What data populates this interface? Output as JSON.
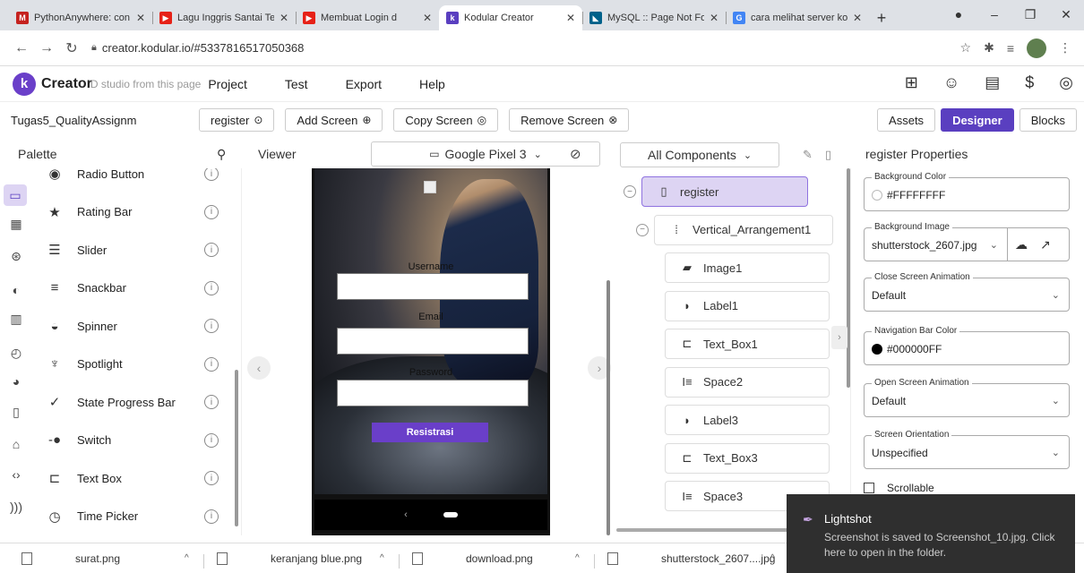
{
  "browser": {
    "tabs": [
      {
        "label": "PythonAnywhere: con",
        "favicon": "M",
        "color": "#c5221f",
        "active": false
      },
      {
        "label": "Lagu Inggris Santai Te",
        "favicon": "▶",
        "color": "#e62117",
        "active": false
      },
      {
        "label": "Membuat Login d",
        "favicon": "▶",
        "color": "#e62117",
        "active": false
      },
      {
        "label": "Kodular Creator",
        "favicon": "k",
        "color": "#5a3fc0",
        "active": true
      },
      {
        "label": "MySQL :: Page Not Fo",
        "favicon": "◣",
        "color": "#00618a",
        "active": false
      },
      {
        "label": "cara melihat server ko",
        "favicon": "G",
        "color": "#4285f4",
        "active": false
      }
    ],
    "new_tab": "+",
    "window_controls": {
      "record": "●",
      "minimize": "–",
      "maximize": "❐",
      "close": "✕"
    },
    "url": "creator.kodular.io/#5337816517050368"
  },
  "app": {
    "brand": "Creator",
    "ghost_text": "D    studio from this page",
    "menu": [
      "Project",
      "Test",
      "Export",
      "Help"
    ],
    "project_name": "Tugas5_QualityAssignm",
    "screen_select": "register",
    "buttons": {
      "add_screen": "Add Screen",
      "copy_screen": "Copy Screen",
      "remove_screen": "Remove Screen"
    },
    "views": {
      "assets": "Assets",
      "designer": "Designer",
      "blocks": "Blocks"
    }
  },
  "palette": {
    "title": "Palette",
    "items": [
      {
        "label": "Radio Button",
        "icon": "◉"
      },
      {
        "label": "Rating Bar",
        "icon": "★"
      },
      {
        "label": "Slider",
        "icon": "☰"
      },
      {
        "label": "Snackbar",
        "icon": "≡"
      },
      {
        "label": "Spinner",
        "icon": "◒"
      },
      {
        "label": "Spotlight",
        "icon": "♆"
      },
      {
        "label": "State Progress Bar",
        "icon": "✓"
      },
      {
        "label": "Switch",
        "icon": "-●"
      },
      {
        "label": "Text Box",
        "icon": "⊏"
      },
      {
        "label": "Time Picker",
        "icon": "◷"
      }
    ]
  },
  "viewer": {
    "title": "Viewer",
    "device": "Google Pixel 3",
    "form": {
      "username_label": "Username",
      "email_label": "Email",
      "password_label": "Password",
      "submit": "Resistrasi"
    }
  },
  "components": {
    "filter": "All Components",
    "tree": [
      {
        "name": "register",
        "level": 0,
        "icon": "▯",
        "selected": true
      },
      {
        "name": "Vertical_Arrangement1",
        "level": 1,
        "icon": "⁞"
      },
      {
        "name": "Image1",
        "level": 2,
        "icon": "▰"
      },
      {
        "name": "Label1",
        "level": 2,
        "icon": "◗"
      },
      {
        "name": "Text_Box1",
        "level": 2,
        "icon": "⊏"
      },
      {
        "name": "Space2",
        "level": 2,
        "icon": "I≡"
      },
      {
        "name": "Label3",
        "level": 2,
        "icon": "◗"
      },
      {
        "name": "Text_Box3",
        "level": 2,
        "icon": "⊏"
      },
      {
        "name": "Space3",
        "level": 2,
        "icon": "I≡"
      }
    ]
  },
  "properties": {
    "title": "register Properties",
    "background_color": {
      "label": "Background Color",
      "value": "#FFFFFFFF",
      "swatch": "#ffffff"
    },
    "background_image": {
      "label": "Background Image",
      "value": "shutterstock_2607.jpg"
    },
    "close_animation": {
      "label": "Close Screen Animation",
      "value": "Default"
    },
    "nav_bar_color": {
      "label": "Navigation Bar Color",
      "value": "#000000FF",
      "swatch": "#000000"
    },
    "open_animation": {
      "label": "Open Screen Animation",
      "value": "Default"
    },
    "orientation": {
      "label": "Screen Orientation",
      "value": "Unspecified"
    },
    "scrollable": "Scrollable"
  },
  "downloads": [
    {
      "name": "surat.png"
    },
    {
      "name": "keranjang blue.png"
    },
    {
      "name": "download.png"
    },
    {
      "name": "shutterstock_2607....jpg"
    }
  ],
  "toast": {
    "title": "Lightshot",
    "message": "Screenshot is saved to Screenshot_10.jpg. Click here to open in the folder."
  }
}
